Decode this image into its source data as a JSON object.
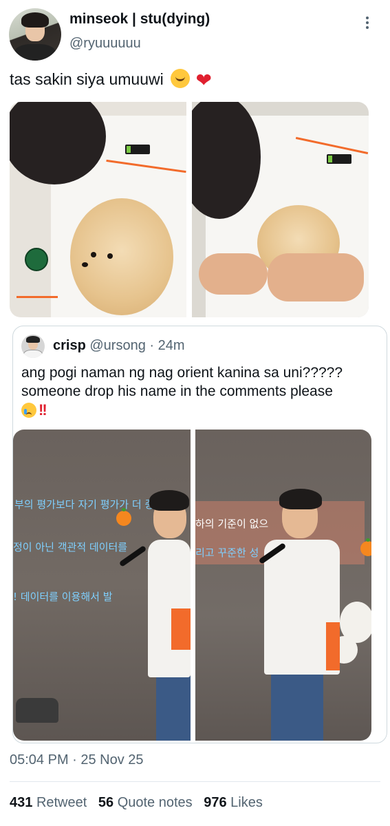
{
  "author": {
    "display_name": "minseok | stu(dying)",
    "handle": "@ryuuuuuu"
  },
  "post": {
    "text": "tas sakin siya umuuwi",
    "emojis": [
      "hugging-face-icon",
      "red-heart-icon"
    ],
    "photos": [
      {
        "name": "photo-person-with-pomeranian"
      },
      {
        "name": "photo-person-holding-pomeranian"
      }
    ]
  },
  "quoted_post": {
    "display_name": "crisp",
    "handle": "@ursong",
    "separator": "·",
    "time": "24m",
    "text_line1": "ang pogi naman ng nag orient kanina sa uni?????",
    "text_line2": "someone drop his name in the comments please",
    "text_emojis": [
      "crying-face-icon",
      "double-exclamation-icon"
    ],
    "photos": [
      {
        "name": "photo-speaker-left",
        "slide_lines": [
          "부의 평가보다 자기 평가가 더 중요",
          "정이 아닌 객관적 데이터를 ",
          "! 데이터를 이용해서 발"
        ]
      },
      {
        "name": "photo-speaker-right",
        "slide_lines": [
          "하의 기준이 없으",
          "리고 꾸준한 성"
        ]
      }
    ]
  },
  "timestamp": "05:04 PM · 25 Nov 25",
  "stats": {
    "retweets_count": "431",
    "retweets_label": "Retweet",
    "quotes_count": "56",
    "quotes_label": "Quote notes",
    "likes_count": "976",
    "likes_label": "Likes"
  },
  "colors": {
    "text_primary": "#0f1419",
    "text_secondary": "#536471",
    "border": "#cfd9de",
    "heart": "#e0202f"
  }
}
